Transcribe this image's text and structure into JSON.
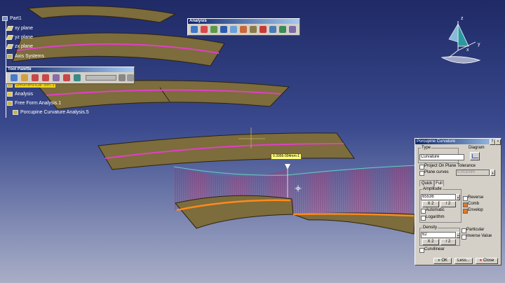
{
  "tree": {
    "root": "Part1",
    "items": [
      "xy plane",
      "yz plane",
      "zx plane",
      "Axis Systems",
      "Geometrical Set.1",
      "Analysis",
      "Free Form Analysis.1",
      "Porcupine Curvature Analysis.5"
    ]
  },
  "analysis_toolbar": {
    "title": "Analysis"
  },
  "tool_palette": {
    "title": "Tool Palette"
  },
  "compass": {
    "axes": [
      "z",
      "x",
      "y"
    ]
  },
  "callout": {
    "text": "0.3956-004mm-1"
  },
  "dialog": {
    "title": "Porcupine Curvature",
    "type_group": "Type",
    "type_value": "Curvature",
    "diagram_label": "Diagram",
    "project_on_plane": "Project On Plane",
    "plane_curves": "Plane curves",
    "tolerance_label": "Tolerance",
    "tolerance_value": "0.001mm",
    "tabs": [
      "Quick",
      "Full"
    ],
    "amplitude_group": "Amplitude",
    "amplitude_value": "65536",
    "x2": "X 2",
    "div2": "/ 2",
    "automatic": "Automatic",
    "logarithm": "Logarithm",
    "reverse": "Reverse",
    "comb": "Comb",
    "envelop": "Envelop",
    "density_group": "Density",
    "density_value": "62",
    "particular": "Particular",
    "inverse_value": "Inverse Value",
    "curvilinear": "Curvilinear",
    "ok": "OK",
    "less": "Less...",
    "close": "Close"
  },
  "colors": {
    "surface": "#7d6c3c",
    "surface_edge": "#2b220e",
    "iso_curve": "#e040c8",
    "analyzed_curve": "#ff8a1e",
    "comb": "#c02060",
    "envelope": "#66d0c0"
  }
}
